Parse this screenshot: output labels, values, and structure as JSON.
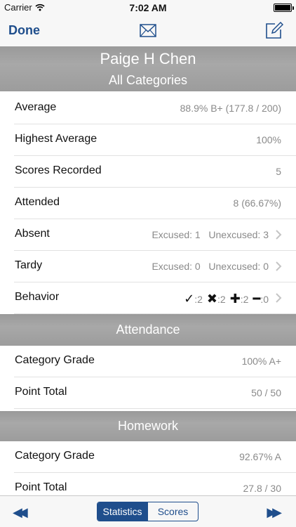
{
  "status": {
    "carrier": "Carrier",
    "time": "7:02 AM"
  },
  "nav": {
    "done": "Done"
  },
  "student": {
    "name": "Paige H Chen",
    "category": "All Categories"
  },
  "summary": {
    "average": {
      "label": "Average",
      "value": "88.9% B+ (177.8 / 200)"
    },
    "highest": {
      "label": "Highest Average",
      "value": "100%"
    },
    "scores": {
      "label": "Scores Recorded",
      "value": "5"
    },
    "attended": {
      "label": "Attended",
      "value": "8 (66.67%)"
    },
    "absent": {
      "label": "Absent",
      "value": "Excused: 1   Unexcused: 3"
    },
    "tardy": {
      "label": "Tardy",
      "value": "Excused: 0   Unexcused: 0"
    },
    "behavior": {
      "label": "Behavior",
      "check_glyph": "✓",
      "check_count": ":2",
      "cross_glyph": "✖",
      "cross_count": ":2",
      "plus_glyph": "✚",
      "plus_count": ":2",
      "minus_glyph": "━",
      "minus_count": ":0"
    }
  },
  "attendance": {
    "title": "Attendance",
    "grade": {
      "label": "Category Grade",
      "value": "100% A+"
    },
    "points": {
      "label": "Point Total",
      "value": "50 / 50"
    }
  },
  "homework": {
    "title": "Homework",
    "grade": {
      "label": "Category Grade",
      "value": "92.67% A"
    },
    "points": {
      "label": "Point Total",
      "value": "27.8 / 30"
    }
  },
  "toolbar": {
    "rewind": "◀◀",
    "forward": "▶▶",
    "seg_statistics": "Statistics",
    "seg_scores": "Scores"
  },
  "colors": {
    "accent": "#1f4e8c",
    "header_gray": "#a0a0a0",
    "value_gray": "#8a8a8a"
  },
  "icons": [
    "wifi-icon",
    "battery-icon",
    "mail-icon",
    "compose-icon",
    "chevron-right-icon",
    "rewind-icon",
    "fast-forward-icon"
  ]
}
